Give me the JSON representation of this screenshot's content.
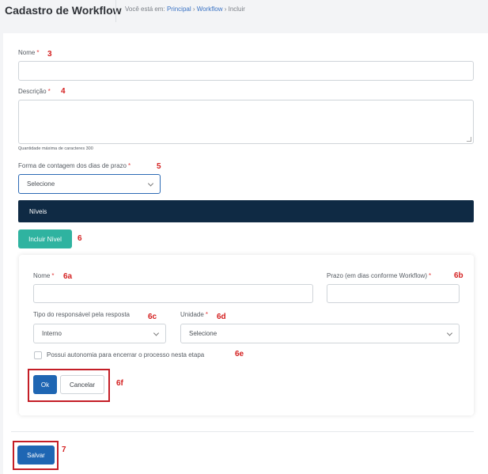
{
  "header": {
    "title": "Cadastro de Workflow",
    "breadcrumb_prefix": "Você está em:",
    "crumb_principal": "Principal",
    "sep1": " › ",
    "crumb_workflow": "Workflow",
    "sep2": " › ",
    "crumb_current": "Incluir"
  },
  "form": {
    "nome_label": "Nome",
    "descricao_label": "Descrição",
    "descricao_hint": "Quantidade máxima de caracteres 300",
    "forma_label": "Forma de contagem dos dias de prazo",
    "forma_value": "Selecione",
    "required_mark": "*"
  },
  "niveis": {
    "section_title": "Níveis",
    "add_button": "Incluir Nível",
    "nome_label": "Nome",
    "prazo_label": "Prazo (em dias conforme Workflow)",
    "tipo_label": "Tipo do responsável pela resposta",
    "tipo_value": "Interno",
    "unidade_label": "Unidade",
    "unidade_value": "Selecione",
    "autonomia_label": "Possui autonomia para encerrar o processo nesta etapa",
    "ok_button": "Ok",
    "cancel_button": "Cancelar"
  },
  "footer": {
    "save_button": "Salvar"
  },
  "annotations": {
    "a3": "3",
    "a4": "4",
    "a5": "5",
    "a6": "6",
    "a6a": "6a",
    "a6b": "6b",
    "a6c": "6c",
    "a6d": "6d",
    "a6e": "6e",
    "a6f": "6f",
    "a7": "7"
  },
  "colors": {
    "accent_blue": "#1e66b3",
    "teal": "#2fb3a0",
    "dark_navy": "#0f2a44",
    "required_red": "#e23b3b",
    "annotation_red": "#d42020"
  }
}
